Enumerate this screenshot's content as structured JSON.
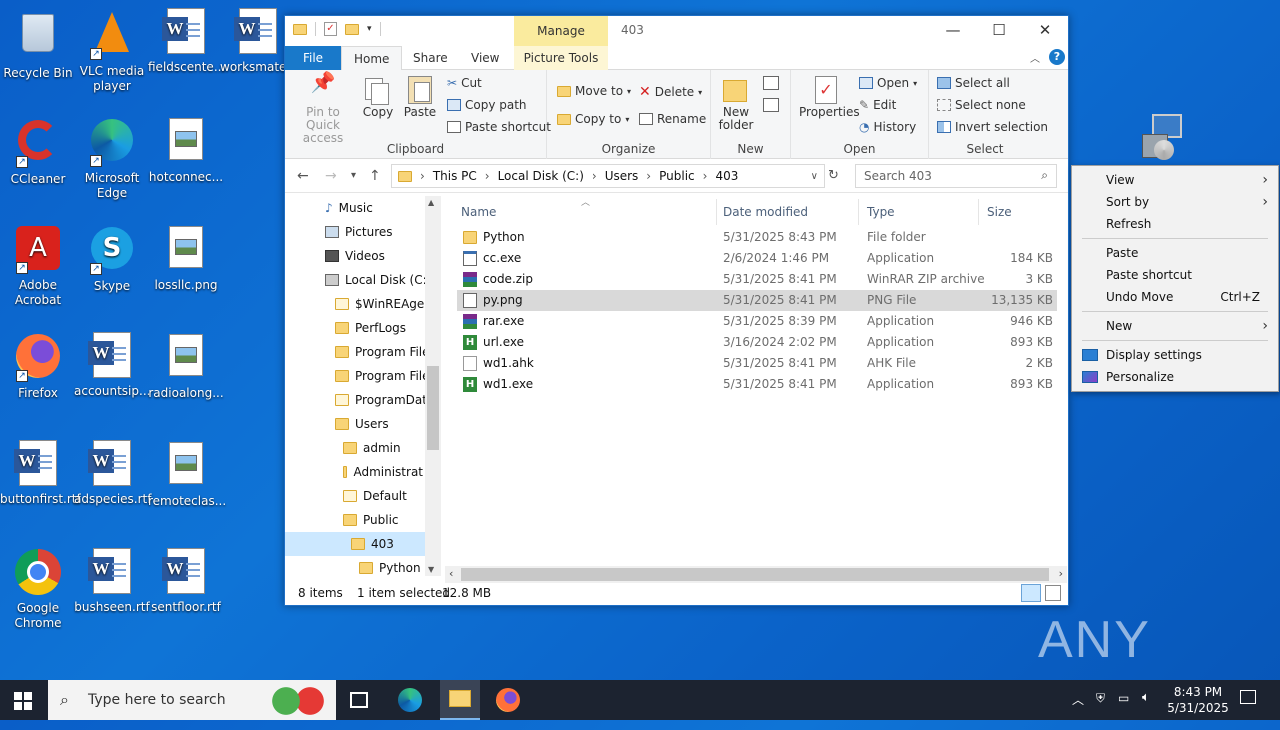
{
  "desktop": {
    "icons": [
      {
        "label": "Recycle Bin"
      },
      {
        "label": "VLC media player"
      },
      {
        "label": "fieldscente..."
      },
      {
        "label": "worksmate..."
      },
      {
        "label": "CCleaner"
      },
      {
        "label": "Microsoft Edge"
      },
      {
        "label": "hotconnec..."
      },
      {
        "label": "Adobe Acrobat"
      },
      {
        "label": "Skype"
      },
      {
        "label": "lossllc.png"
      },
      {
        "label": "Firefox"
      },
      {
        "label": "accountsip..."
      },
      {
        "label": "radioalong..."
      },
      {
        "label": "buttonfirst.rtf"
      },
      {
        "label": "adspecies.rtf"
      },
      {
        "label": "remoteclas..."
      },
      {
        "label": "Google Chrome"
      },
      {
        "label": "bushseen.rtf"
      },
      {
        "label": "sentfloor.rtf"
      }
    ],
    "watermark": "ANY RUN"
  },
  "explorer": {
    "title": "403",
    "manage_tab": "Manage",
    "tabs": {
      "file": "File",
      "home": "Home",
      "share": "Share",
      "view": "View",
      "picture_tools": "Picture Tools"
    },
    "ribbon": {
      "clipboard": {
        "label": "Clipboard",
        "pin": "Pin to Quick access",
        "copy": "Copy",
        "paste": "Paste",
        "cut": "Cut",
        "copy_path": "Copy path",
        "paste_shortcut": "Paste shortcut"
      },
      "organize": {
        "label": "Organize",
        "move_to": "Move to",
        "copy_to": "Copy to",
        "delete": "Delete",
        "rename": "Rename"
      },
      "new": {
        "label": "New",
        "new_folder": "New folder"
      },
      "open": {
        "label": "Open",
        "properties": "Properties",
        "open": "Open",
        "edit": "Edit",
        "history": "History"
      },
      "select": {
        "label": "Select",
        "select_all": "Select all",
        "select_none": "Select none",
        "invert": "Invert selection"
      }
    },
    "address": {
      "crumbs": [
        "This PC",
        "Local Disk (C:)",
        "Users",
        "Public",
        "403"
      ],
      "search_placeholder": "Search 403"
    },
    "nav": [
      {
        "label": "Music"
      },
      {
        "label": "Pictures"
      },
      {
        "label": "Videos"
      },
      {
        "label": "Local Disk (C:)"
      },
      {
        "label": "$WinREAgent"
      },
      {
        "label": "PerfLogs"
      },
      {
        "label": "Program Files"
      },
      {
        "label": "Program Files"
      },
      {
        "label": "ProgramData"
      },
      {
        "label": "Users"
      },
      {
        "label": "admin"
      },
      {
        "label": "Administrat"
      },
      {
        "label": "Default"
      },
      {
        "label": "Public"
      },
      {
        "label": "403"
      },
      {
        "label": "Python"
      }
    ],
    "columns": {
      "name": "Name",
      "date": "Date modified",
      "type": "Type",
      "size": "Size"
    },
    "files": [
      {
        "name": "Python",
        "date": "5/31/2025 8:43 PM",
        "type": "File folder",
        "size": ""
      },
      {
        "name": "cc.exe",
        "date": "2/6/2024 1:46 PM",
        "type": "Application",
        "size": "184 KB"
      },
      {
        "name": "code.zip",
        "date": "5/31/2025 8:41 PM",
        "type": "WinRAR ZIP archive",
        "size": "3 KB"
      },
      {
        "name": "py.png",
        "date": "5/31/2025 8:41 PM",
        "type": "PNG File",
        "size": "13,135 KB"
      },
      {
        "name": "rar.exe",
        "date": "5/31/2025 8:39 PM",
        "type": "Application",
        "size": "946 KB"
      },
      {
        "name": "url.exe",
        "date": "3/16/2024 2:02 PM",
        "type": "Application",
        "size": "893 KB"
      },
      {
        "name": "wd1.ahk",
        "date": "5/31/2025 8:41 PM",
        "type": "AHK File",
        "size": "2 KB"
      },
      {
        "name": "wd1.exe",
        "date": "5/31/2025 8:41 PM",
        "type": "Application",
        "size": "893 KB"
      }
    ],
    "status": {
      "count": "8 items",
      "selected": "1 item selected",
      "size": "12.8 MB"
    }
  },
  "context_menu": {
    "view": "View",
    "sort_by": "Sort by",
    "refresh": "Refresh",
    "paste": "Paste",
    "paste_shortcut": "Paste shortcut",
    "undo_move": "Undo Move",
    "undo_accel": "Ctrl+Z",
    "new": "New",
    "display_settings": "Display settings",
    "personalize": "Personalize"
  },
  "taskbar": {
    "search_placeholder": "Type here to search",
    "time": "8:43 PM",
    "date": "5/31/2025"
  }
}
